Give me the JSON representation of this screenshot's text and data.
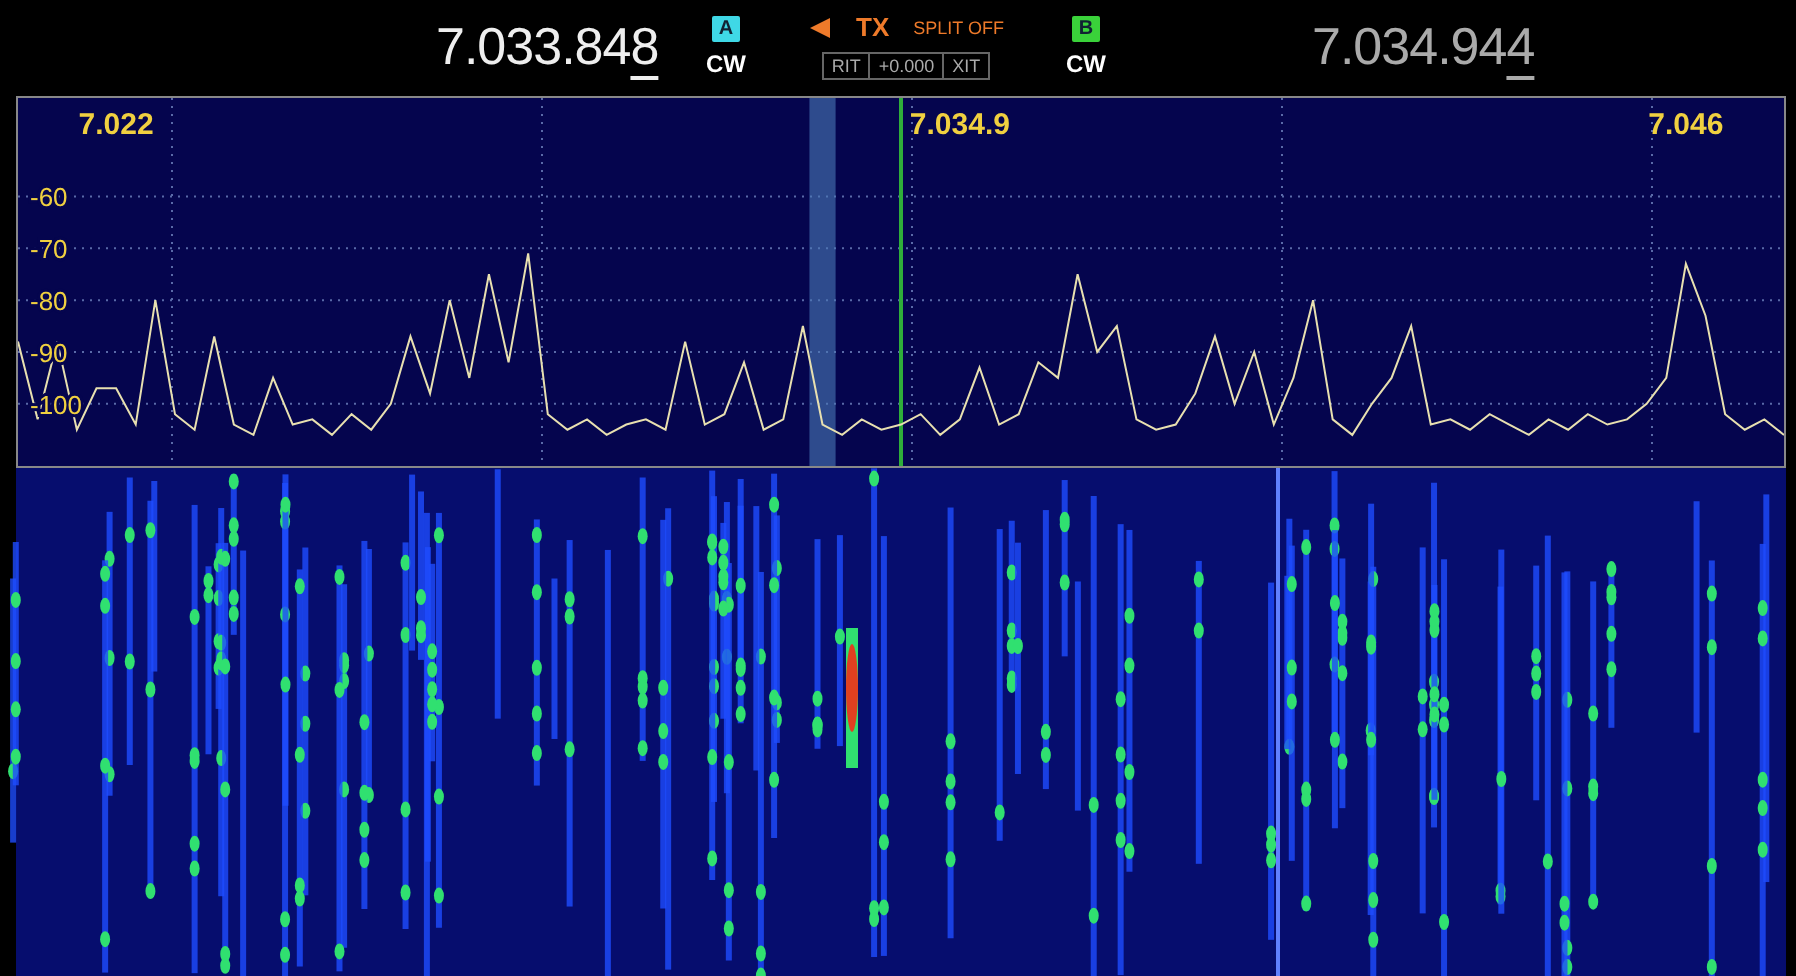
{
  "vfos": [
    {
      "badge": "A",
      "frequency": "7.033.848",
      "mode": "CW",
      "selected": true,
      "color": "#3fd8e6"
    },
    {
      "badge": "B",
      "frequency": "7.034.944",
      "mode": "CW",
      "selected": false,
      "color": "#3ad23a"
    }
  ],
  "tx": {
    "label": "TX",
    "split": "SPLIT OFF"
  },
  "offset": {
    "rit": "RIT",
    "value": "+0.000",
    "xit": "XIT"
  },
  "spectrum": {
    "chart_data": {
      "type": "line",
      "grid": true,
      "bands": [
        {
          "axis": "x",
          "from": 7032.6,
          "to": 7033.0,
          "color": "#4a7ab8"
        }
      ],
      "ref_lines": [
        {
          "axis": "x",
          "value": 7034.0,
          "color": "#2fae3a"
        }
      ],
      "xlim": [
        7020.5,
        7047.5
      ],
      "ylim": [
        -112,
        -41
      ],
      "xticks": [
        {
          "value": 7022,
          "label": "7.022"
        },
        {
          "value": 7034.9,
          "label": "7.034.9"
        },
        {
          "value": 7046,
          "label": "7.046"
        }
      ],
      "x": [
        7020.5,
        7020.8,
        7021.1,
        7021.4,
        7021.7,
        7022,
        7022.3,
        7022.6,
        7022.9,
        7023.2,
        7023.5,
        7023.8,
        7024.1,
        7024.4,
        7024.7,
        7025,
        7025.3,
        7025.6,
        7025.9,
        7026.2,
        7026.5,
        7026.8,
        7027.1,
        7027.4,
        7027.7,
        7028,
        7028.3,
        7028.6,
        7028.9,
        7029.2,
        7029.5,
        7029.8,
        7030.1,
        7030.4,
        7030.7,
        7031,
        7031.3,
        7031.6,
        7031.9,
        7032.2,
        7032.5,
        7032.8,
        7033.1,
        7033.4,
        7033.7,
        7034,
        7034.3,
        7034.6,
        7034.9,
        7035.2,
        7035.5,
        7035.8,
        7036.1,
        7036.4,
        7036.7,
        7037,
        7037.3,
        7037.6,
        7037.9,
        7038.2,
        7038.5,
        7038.8,
        7039.1,
        7039.4,
        7039.7,
        7040,
        7040.3,
        7040.6,
        7040.9,
        7041.2,
        7041.5,
        7041.8,
        7042.1,
        7042.4,
        7042.7,
        7043,
        7043.3,
        7043.6,
        7043.9,
        7044.2,
        7044.5,
        7044.8,
        7045.1,
        7045.4,
        7045.7,
        7046,
        7046.3,
        7046.6,
        7046.9,
        7047.2,
        7047.5
      ],
      "yticks": [
        -60,
        -70,
        -80,
        -90,
        -100
      ],
      "series": [
        {
          "color": "#e8e0b0",
          "values": [
            -88,
            -103,
            -88,
            -105,
            -97,
            -97,
            -104,
            -80,
            -102,
            -105,
            -87,
            -104,
            -106,
            -95,
            -104,
            -103,
            -106,
            -102,
            -105,
            -100,
            -87,
            -98,
            -80,
            -95,
            -75,
            -92,
            -71,
            -102,
            -105,
            -103,
            -106,
            -104,
            -103,
            -105,
            -88,
            -104,
            -102,
            -92,
            -105,
            -103,
            -85,
            -104,
            -106,
            -103,
            -105,
            -104,
            -102,
            -106,
            -103,
            -93,
            -104,
            -102,
            -92,
            -95,
            -75,
            -90,
            -85,
            -103,
            -105,
            -104,
            -98,
            -87,
            -100,
            -90,
            -104,
            -95,
            -80,
            -103,
            -106,
            -100,
            -95,
            -85,
            -104,
            -103,
            -105,
            -102,
            -104,
            -106,
            -103,
            -105,
            -102,
            -104,
            -103,
            -100,
            -95,
            -73,
            -83,
            -102,
            -105,
            -103,
            -106
          ]
        }
      ]
    }
  }
}
